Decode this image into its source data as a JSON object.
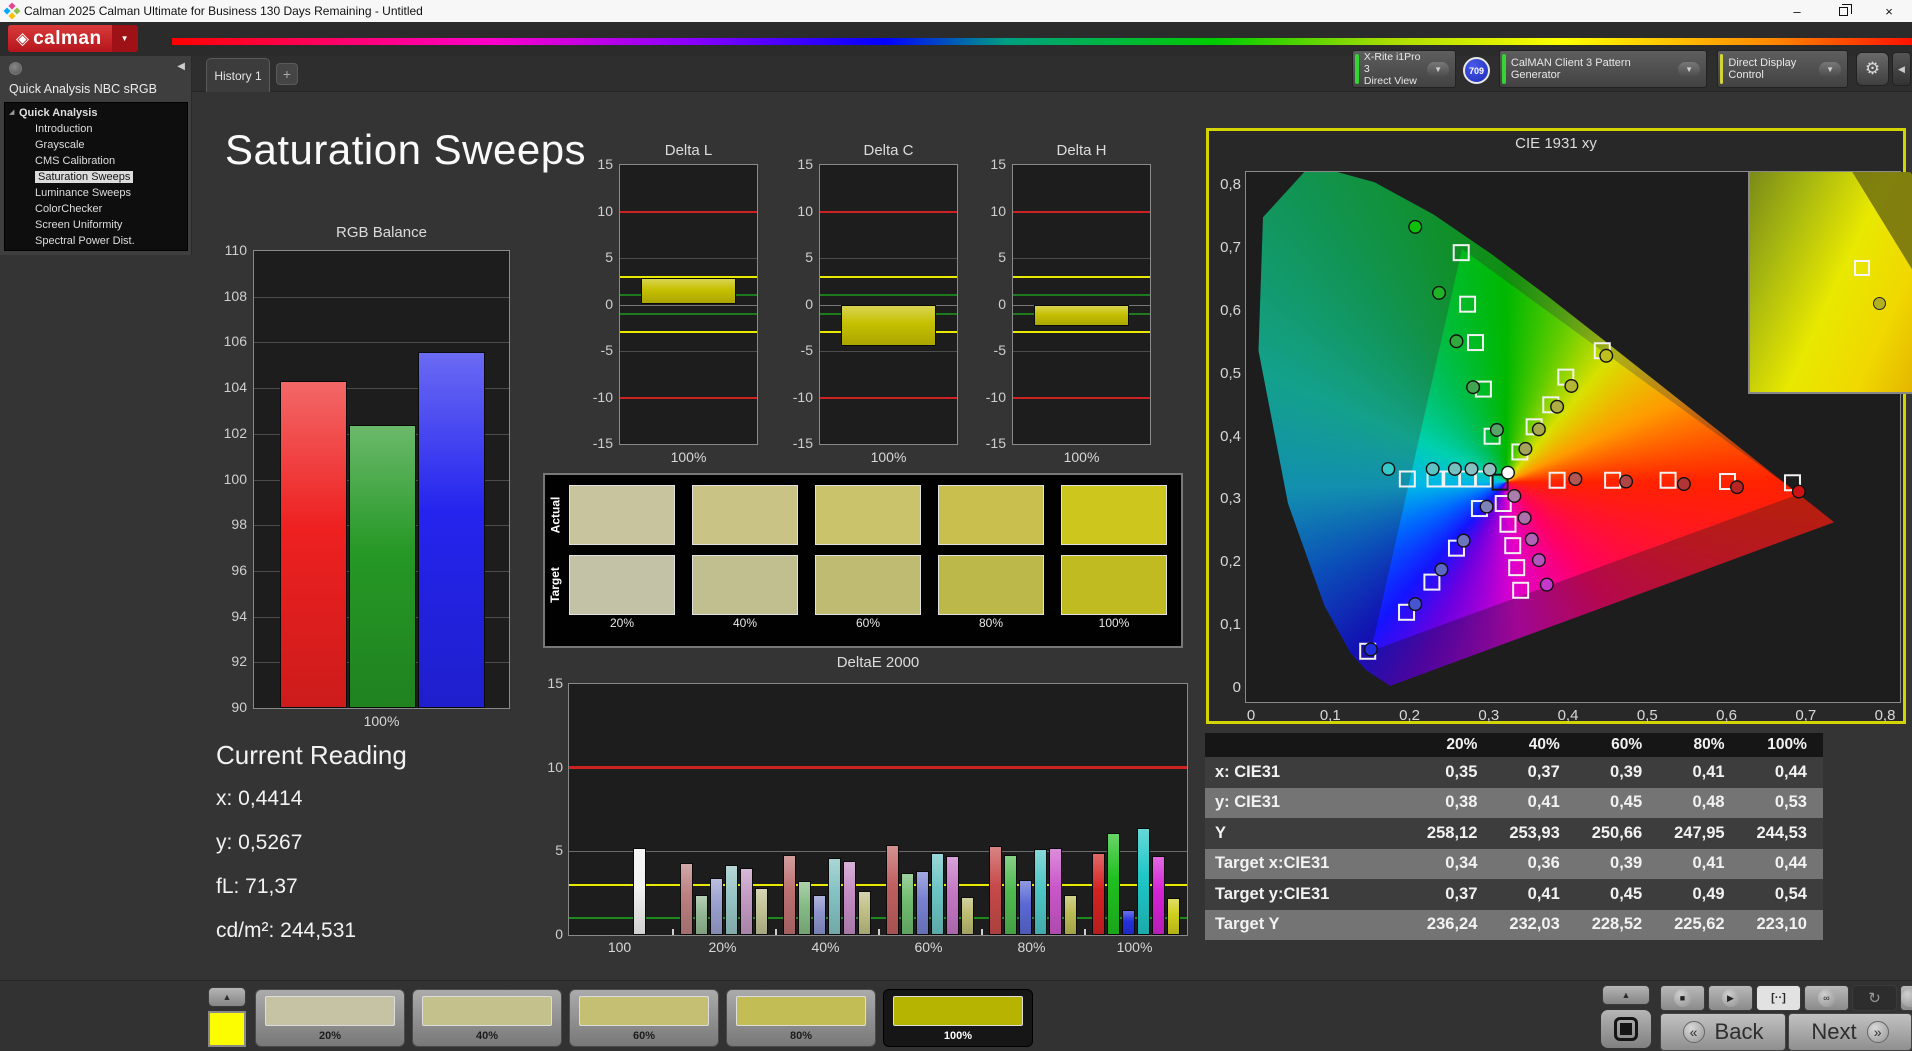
{
  "window": {
    "title": "Calman 2025 Calman Ultimate for Business 130 Days Remaining  - Untitled",
    "minimize": "–",
    "close": "×"
  },
  "icons": {
    "logo_diamond": "◈",
    "chevron_down": "▼",
    "dropdown_arrow": "▼",
    "collapse_left": "◀",
    "collapse_right": "◀",
    "gear": "⚙",
    "add": "+",
    "tree_expander": "◢",
    "up": "▲",
    "play": "▶",
    "stop": "■",
    "infinity": "∞",
    "loop": "↻",
    "pattern_window": "[··]",
    "back_arrow": "«",
    "next_arrow": "»"
  },
  "brand": {
    "logo": "calman"
  },
  "tab_bar": {
    "tabs": [
      {
        "label": "History 1",
        "active": true
      }
    ],
    "add": "+"
  },
  "toolbar": {
    "meter": {
      "line1": "X-Rite i1Pro 3",
      "line2": "Direct View",
      "status_color": "#35d435"
    },
    "badge": {
      "text": "709",
      "color": "#2436d4"
    },
    "pattern": {
      "label": "CalMAN Client 3 Pattern Generator",
      "status_color": "#35d435"
    },
    "display": {
      "label": "Direct Display Control",
      "status_color": "#d4d435"
    }
  },
  "sidebar": {
    "title": "Quick Analysis NBC sRGB",
    "tree": [
      {
        "label": "Quick Analysis",
        "root": true
      },
      {
        "label": "Introduction"
      },
      {
        "label": "Grayscale"
      },
      {
        "label": "CMS Calibration"
      },
      {
        "label": "Saturation Sweeps",
        "selected": true
      },
      {
        "label": "Luminance Sweeps"
      },
      {
        "label": "ColorChecker"
      },
      {
        "label": "Screen Uniformity"
      },
      {
        "label": "Spectral Power Dist."
      }
    ]
  },
  "page": {
    "title": "Saturation Sweeps"
  },
  "current_reading": {
    "title": "Current Reading",
    "lines": [
      {
        "label": "x:",
        "value": "0,4414"
      },
      {
        "label": "y:",
        "value": "0,5267"
      },
      {
        "label": "fL:",
        "value": "71,37"
      },
      {
        "label": "cd/m²:",
        "value": "244,531"
      }
    ]
  },
  "swatch_panel": {
    "row_labels": [
      "Actual",
      "Target"
    ],
    "columns": [
      "20%",
      "40%",
      "60%",
      "80%",
      "100%"
    ],
    "actual": [
      "#c8c49d",
      "#c9c386",
      "#cac36c",
      "#c8bf4f",
      "#cdc71d"
    ],
    "target": [
      "#c3c2a6",
      "#c1be8f",
      "#c0bb73",
      "#bcb84a",
      "#c1bb22"
    ]
  },
  "table": {
    "header": [
      "",
      "20%",
      "40%",
      "60%",
      "80%",
      "100%"
    ],
    "rows": [
      {
        "label": "x: CIE31",
        "values": [
          "0,35",
          "0,37",
          "0,39",
          "0,41",
          "0,44"
        ]
      },
      {
        "label": "y: CIE31",
        "values": [
          "0,38",
          "0,41",
          "0,45",
          "0,48",
          "0,53"
        ]
      },
      {
        "label": "Y",
        "values": [
          "258,12",
          "253,93",
          "250,66",
          "247,95",
          "244,53"
        ]
      },
      {
        "label": "Target x:CIE31",
        "values": [
          "0,34",
          "0,36",
          "0,39",
          "0,41",
          "0,44"
        ]
      },
      {
        "label": "Target y:CIE31",
        "values": [
          "0,37",
          "0,41",
          "0,45",
          "0,49",
          "0,54"
        ]
      },
      {
        "label": "Target Y",
        "values": [
          "236,24",
          "232,03",
          "228,52",
          "225,62",
          "223,10"
        ]
      }
    ]
  },
  "bottom_bar": {
    "patches": [
      {
        "label": "20%",
        "color": "#c6c3a4"
      },
      {
        "label": "40%",
        "color": "#c5c18c"
      },
      {
        "label": "60%",
        "color": "#c4bf72"
      },
      {
        "label": "80%",
        "color": "#c3bd56"
      },
      {
        "label": "100%",
        "color": "#b7b400",
        "selected": true
      }
    ],
    "current_patch_color": "#fdfd02",
    "nav_back": "Back",
    "nav_next": "Next"
  },
  "chart_data": [
    {
      "id": "rgb_balance",
      "type": "bar",
      "title": "RGB Balance",
      "xlabel": "100%",
      "ylim": [
        90,
        110
      ],
      "ytick_step": 2,
      "grid": true,
      "series": [
        {
          "name": "Red",
          "value": 104.3,
          "color": "#ee2020"
        },
        {
          "name": "Green",
          "value": 102.4,
          "color": "#259825"
        },
        {
          "name": "Blue",
          "value": 105.6,
          "color": "#2424ee"
        }
      ]
    },
    {
      "id": "delta_l",
      "type": "bar",
      "title": "Delta L",
      "xlabel": "100%",
      "ylim": [
        -15,
        15
      ],
      "ytick_step": 5,
      "value": 2.8,
      "bar_color": "#c6c000",
      "limits": {
        "red": 10,
        "yellow": 3,
        "green": 1
      }
    },
    {
      "id": "delta_c",
      "type": "bar",
      "title": "Delta C",
      "xlabel": "100%",
      "ylim": [
        -15,
        15
      ],
      "ytick_step": 5,
      "value": -4.5,
      "bar_color": "#c6c000",
      "limits": {
        "red": 10,
        "yellow": 3,
        "green": 1
      }
    },
    {
      "id": "delta_h",
      "type": "bar",
      "title": "Delta H",
      "xlabel": "100%",
      "ylim": [
        -15,
        15
      ],
      "ytick_step": 5,
      "value": -2.3,
      "bar_color": "#c6c000",
      "limits": {
        "red": 10,
        "yellow": 3,
        "green": 1
      }
    },
    {
      "id": "deltae2000",
      "type": "bar",
      "title": "DeltaE 2000",
      "ylim": [
        0,
        15
      ],
      "yticks": [
        0,
        5,
        10,
        15
      ],
      "limits": {
        "red": 10,
        "yellow": 3,
        "green": 1
      },
      "groups": [
        {
          "label": "100",
          "bars": [
            {
              "value": 5.2,
              "color": "#f2f2f2"
            }
          ]
        },
        {
          "label": "20%",
          "bars": [
            {
              "value": 4.3,
              "color": "#bb7f7f"
            },
            {
              "value": 2.4,
              "color": "#94b894"
            },
            {
              "value": 3.4,
              "color": "#9aa0cf"
            },
            {
              "value": 4.2,
              "color": "#96c4c4"
            },
            {
              "value": 4.0,
              "color": "#c29ac2"
            },
            {
              "value": 2.8,
              "color": "#c2c294"
            }
          ]
        },
        {
          "label": "40%",
          "bars": [
            {
              "value": 4.8,
              "color": "#bc7070"
            },
            {
              "value": 3.2,
              "color": "#85bb85"
            },
            {
              "value": 2.4,
              "color": "#8b93cc"
            },
            {
              "value": 4.6,
              "color": "#84c2c2"
            },
            {
              "value": 4.4,
              "color": "#c38bc3"
            },
            {
              "value": 2.6,
              "color": "#bfbf85"
            }
          ]
        },
        {
          "label": "60%",
          "bars": [
            {
              "value": 5.4,
              "color": "#c05f5f"
            },
            {
              "value": 3.7,
              "color": "#6fbb6f"
            },
            {
              "value": 3.8,
              "color": "#7781d0"
            },
            {
              "value": 4.9,
              "color": "#6cc4c4"
            },
            {
              "value": 4.7,
              "color": "#c577c5"
            },
            {
              "value": 2.3,
              "color": "#bcbc72"
            }
          ]
        },
        {
          "label": "80%",
          "bars": [
            {
              "value": 5.3,
              "color": "#c64a4a"
            },
            {
              "value": 4.8,
              "color": "#4fba4f"
            },
            {
              "value": 3.3,
              "color": "#5a68d4"
            },
            {
              "value": 5.15,
              "color": "#4ec6c6"
            },
            {
              "value": 5.2,
              "color": "#ca57ca"
            },
            {
              "value": 2.4,
              "color": "#bcbc55"
            }
          ]
        },
        {
          "label": "100%",
          "bars": [
            {
              "value": 4.9,
              "color": "#d42222"
            },
            {
              "value": 6.1,
              "color": "#1fc01f"
            },
            {
              "value": 1.5,
              "color": "#2330dd"
            },
            {
              "value": 6.4,
              "color": "#1fc6c6"
            },
            {
              "value": 4.7,
              "color": "#d422d4"
            },
            {
              "value": 2.2,
              "color": "#cfcf1d"
            }
          ]
        }
      ]
    },
    {
      "id": "cie",
      "type": "scatter",
      "title": "CIE 1931 xy",
      "xlim": [
        0,
        0.8
      ],
      "ylim": [
        0,
        0.8
      ],
      "xticks": [
        "0",
        "0,1",
        "0,2",
        "0,3",
        "0,4",
        "0,5",
        "0,6",
        "0,7",
        "0,8"
      ],
      "yticks": [
        "0",
        "0,1",
        "0,2",
        "0,3",
        "0,4",
        "0,5",
        "0,6",
        "0,7",
        "0,8"
      ],
      "gamut_triangle": [
        [
          0.69,
          0.31
        ],
        [
          0.265,
          0.7
        ],
        [
          0.15,
          0.06
        ]
      ],
      "white_target": {
        "x": 0.313,
        "y": 0.329
      },
      "targets": [
        [
          0.385,
          0.332
        ],
        [
          0.455,
          0.332
        ],
        [
          0.525,
          0.332
        ],
        [
          0.6,
          0.33
        ],
        [
          0.682,
          0.328
        ],
        [
          0.303,
          0.402
        ],
        [
          0.292,
          0.477
        ],
        [
          0.282,
          0.551
        ],
        [
          0.272,
          0.612
        ],
        [
          0.264,
          0.694
        ],
        [
          0.287,
          0.287
        ],
        [
          0.258,
          0.224
        ],
        [
          0.227,
          0.17
        ],
        [
          0.195,
          0.122
        ],
        [
          0.146,
          0.06
        ],
        [
          0.292,
          0.334
        ],
        [
          0.272,
          0.334
        ],
        [
          0.252,
          0.334
        ],
        [
          0.231,
          0.334
        ],
        [
          0.196,
          0.334
        ],
        [
          0.317,
          0.295
        ],
        [
          0.323,
          0.262
        ],
        [
          0.329,
          0.228
        ],
        [
          0.334,
          0.193
        ],
        [
          0.339,
          0.157
        ],
        [
          0.338,
          0.377
        ],
        [
          0.356,
          0.417
        ],
        [
          0.377,
          0.452
        ],
        [
          0.396,
          0.496
        ],
        [
          0.442,
          0.538
        ]
      ],
      "points": [
        [
          0.408,
          0.334,
          "#b25555"
        ],
        [
          0.472,
          0.33,
          "#b04545"
        ],
        [
          0.545,
          0.326,
          "#b23535"
        ],
        [
          0.612,
          0.321,
          "#b82525"
        ],
        [
          0.69,
          0.314,
          "#cc1212"
        ],
        [
          0.309,
          0.412,
          "#57a567"
        ],
        [
          0.279,
          0.48,
          "#41a54f"
        ],
        [
          0.258,
          0.553,
          "#30aa3c"
        ],
        [
          0.236,
          0.63,
          "#1fb428"
        ],
        [
          0.206,
          0.735,
          "#0cc00c"
        ],
        [
          0.296,
          0.29,
          "#7d82b8"
        ],
        [
          0.267,
          0.236,
          "#6c74bd"
        ],
        [
          0.239,
          0.19,
          "#5b66c5"
        ],
        [
          0.206,
          0.135,
          "#4754cf"
        ],
        [
          0.15,
          0.063,
          "#1f2ede"
        ],
        [
          0.3,
          0.349,
          "#93bfbf"
        ],
        [
          0.277,
          0.35,
          "#86bfbf"
        ],
        [
          0.256,
          0.35,
          "#74bfbf"
        ],
        [
          0.228,
          0.35,
          "#5cc2c2"
        ],
        [
          0.172,
          0.35,
          "#35c8c8"
        ],
        [
          0.331,
          0.307,
          "#ab7dab"
        ],
        [
          0.344,
          0.272,
          "#ad70ad"
        ],
        [
          0.353,
          0.238,
          "#b162b6"
        ],
        [
          0.362,
          0.205,
          "#b554bc"
        ],
        [
          0.372,
          0.166,
          "#c438cc"
        ],
        [
          0.345,
          0.382,
          "#a3a35a"
        ],
        [
          0.362,
          0.413,
          "#a8a84e"
        ],
        [
          0.385,
          0.449,
          "#aeae42"
        ],
        [
          0.403,
          0.482,
          "#b5b534"
        ],
        [
          0.447,
          0.53,
          "#bfbf1d"
        ],
        [
          0.323,
          0.344,
          "#ffffff"
        ]
      ],
      "inset": {
        "square": {
          "left": 0.56,
          "top": 0.4
        },
        "dot": {
          "left": 0.66,
          "top": 0.57
        }
      }
    }
  ]
}
